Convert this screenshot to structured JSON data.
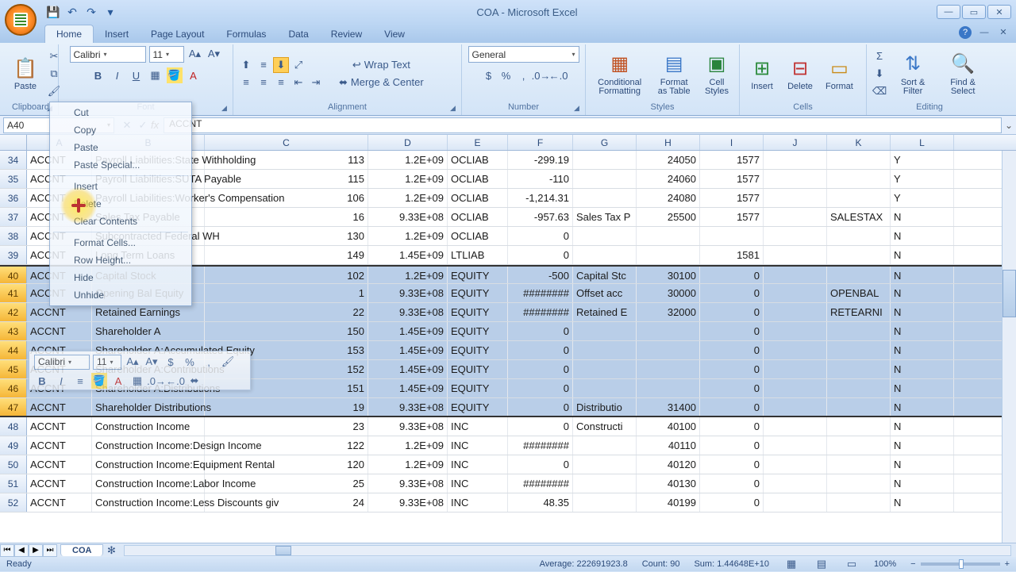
{
  "title": "COA - Microsoft Excel",
  "tabs": [
    "Home",
    "Insert",
    "Page Layout",
    "Formulas",
    "Data",
    "Review",
    "View"
  ],
  "active_tab": "Home",
  "qat": {
    "save": "💾",
    "undo": "↶",
    "redo": "↷"
  },
  "ribbon": {
    "clipboard": {
      "label": "Clipboard",
      "paste": "Paste"
    },
    "font": {
      "label": "Font",
      "name": "Calibri",
      "size": "11"
    },
    "alignment": {
      "label": "Alignment",
      "wrap": "Wrap Text",
      "merge": "Merge & Center"
    },
    "number": {
      "label": "Number",
      "fmt": "General"
    },
    "styles": {
      "label": "Styles",
      "cond": "Conditional Formatting",
      "tbl": "Format as Table",
      "cell": "Cell Styles"
    },
    "cells": {
      "label": "Cells",
      "insert": "Insert",
      "delete": "Delete",
      "format": "Format"
    },
    "editing": {
      "label": "Editing",
      "sort": "Sort & Filter",
      "find": "Find & Select"
    }
  },
  "name_box": "A40",
  "formula": "ACCNT",
  "columns": [
    "A",
    "B",
    "C",
    "D",
    "E",
    "F",
    "G",
    "H",
    "I",
    "J",
    "K",
    "L"
  ],
  "col_widths": [
    "c-A",
    "c-B",
    "c-C",
    "c-D",
    "c-E",
    "c-F",
    "c-G",
    "c-H",
    "c-I",
    "c-J",
    "c-K",
    "c-L"
  ],
  "rows": [
    {
      "n": 34,
      "A": "ACCNT",
      "B": "Payroll Liabilities:State Withholding",
      "C": "113",
      "D": "1.2E+09",
      "E": "OCLIAB",
      "F": "-299.19",
      "G": "",
      "H": "24050",
      "I": "1577",
      "J": "",
      "K": "",
      "L": "Y"
    },
    {
      "n": 35,
      "A": "ACCNT",
      "B": "Payroll Liabilities:SUTA Payable",
      "C": "115",
      "D": "1.2E+09",
      "E": "OCLIAB",
      "F": "-110",
      "G": "",
      "H": "24060",
      "I": "1577",
      "J": "",
      "K": "",
      "L": "Y"
    },
    {
      "n": 36,
      "A": "ACCNT",
      "B": "Payroll Liabilities:Worker's Compensation",
      "C": "106",
      "D": "1.2E+09",
      "E": "OCLIAB",
      "F": "-1,214.31",
      "G": "",
      "H": "24080",
      "I": "1577",
      "J": "",
      "K": "",
      "L": "Y"
    },
    {
      "n": 37,
      "A": "ACCNT",
      "B": "Sales Tax Payable",
      "C": "16",
      "D": "9.33E+08",
      "E": "OCLIAB",
      "F": "-957.63",
      "G": "Sales Tax P",
      "H": "25500",
      "I": "1577",
      "J": "",
      "K": "SALESTAX",
      "L": "N"
    },
    {
      "n": 38,
      "A": "ACCNT",
      "B": "Subcontracted Federal WH",
      "C": "130",
      "D": "1.2E+09",
      "E": "OCLIAB",
      "F": "0",
      "G": "",
      "H": "",
      "I": "",
      "J": "",
      "K": "",
      "L": "N"
    },
    {
      "n": 39,
      "A": "ACCNT",
      "B": "Long Term Loans",
      "C": "149",
      "D": "1.45E+09",
      "E": "LTLIAB",
      "F": "0",
      "G": "",
      "H": "",
      "I": "1581",
      "J": "",
      "K": "",
      "L": "N"
    },
    {
      "n": 40,
      "sel": true,
      "A": "ACCNT",
      "B": "Capital Stock",
      "C": "102",
      "D": "1.2E+09",
      "E": "EQUITY",
      "F": "-500",
      "G": "Capital Stc",
      "H": "30100",
      "I": "0",
      "J": "",
      "K": "",
      "L": "N"
    },
    {
      "n": 41,
      "sel": true,
      "A": "ACCNT",
      "B": "Opening Bal Equity",
      "C": "1",
      "D": "9.33E+08",
      "E": "EQUITY",
      "F": "########",
      "G": "Offset acc",
      "H": "30000",
      "I": "0",
      "J": "",
      "K": "OPENBAL",
      "L": "N"
    },
    {
      "n": 42,
      "sel": true,
      "A": "ACCNT",
      "B": "Retained Earnings",
      "C": "22",
      "D": "9.33E+08",
      "E": "EQUITY",
      "F": "########",
      "G": "Retained E",
      "H": "32000",
      "I": "0",
      "J": "",
      "K": "RETEARNI",
      "L": "N"
    },
    {
      "n": 43,
      "sel": true,
      "A": "ACCNT",
      "B": "Shareholder A",
      "C": "150",
      "D": "1.45E+09",
      "E": "EQUITY",
      "F": "0",
      "G": "",
      "H": "",
      "I": "0",
      "J": "",
      "K": "",
      "L": "N"
    },
    {
      "n": 44,
      "sel": true,
      "A": "ACCNT",
      "B": "Shareholder A:Accumulated Equity",
      "C": "153",
      "D": "1.45E+09",
      "E": "EQUITY",
      "F": "0",
      "G": "",
      "H": "",
      "I": "0",
      "J": "",
      "K": "",
      "L": "N"
    },
    {
      "n": 45,
      "sel": true,
      "A": "ACCNT",
      "B": "Shareholder A:Contributions",
      "C": "152",
      "D": "1.45E+09",
      "E": "EQUITY",
      "F": "0",
      "G": "",
      "H": "",
      "I": "0",
      "J": "",
      "K": "",
      "L": "N"
    },
    {
      "n": 46,
      "sel": true,
      "A": "ACCNT",
      "B": "Shareholder A:Distributions",
      "C": "151",
      "D": "1.45E+09",
      "E": "EQUITY",
      "F": "0",
      "G": "",
      "H": "",
      "I": "0",
      "J": "",
      "K": "",
      "L": "N"
    },
    {
      "n": 47,
      "sel": true,
      "A": "ACCNT",
      "B": "Shareholder Distributions",
      "C": "19",
      "D": "9.33E+08",
      "E": "EQUITY",
      "F": "0",
      "G": "Distributio",
      "H": "31400",
      "I": "0",
      "J": "",
      "K": "",
      "L": "N"
    },
    {
      "n": 48,
      "A": "ACCNT",
      "B": "Construction Income",
      "C": "23",
      "D": "9.33E+08",
      "E": "INC",
      "F": "0",
      "G": "Constructi",
      "H": "40100",
      "I": "0",
      "J": "",
      "K": "",
      "L": "N"
    },
    {
      "n": 49,
      "A": "ACCNT",
      "B": "Construction Income:Design Income",
      "C": "122",
      "D": "1.2E+09",
      "E": "INC",
      "F": "########",
      "G": "",
      "H": "40110",
      "I": "0",
      "J": "",
      "K": "",
      "L": "N"
    },
    {
      "n": 50,
      "A": "ACCNT",
      "B": "Construction Income:Equipment Rental",
      "C": "120",
      "D": "1.2E+09",
      "E": "INC",
      "F": "0",
      "G": "",
      "H": "40120",
      "I": "0",
      "J": "",
      "K": "",
      "L": "N"
    },
    {
      "n": 51,
      "A": "ACCNT",
      "B": "Construction Income:Labor Income",
      "C": "25",
      "D": "9.33E+08",
      "E": "INC",
      "F": "########",
      "G": "",
      "H": "40130",
      "I": "0",
      "J": "",
      "K": "",
      "L": "N"
    },
    {
      "n": 52,
      "A": "ACCNT",
      "B": "Construction Income:Less Discounts giv",
      "C": "24",
      "D": "9.33E+08",
      "E": "INC",
      "F": "48.35",
      "G": "",
      "H": "40199",
      "I": "0",
      "J": "",
      "K": "",
      "L": "N"
    }
  ],
  "context_menu": [
    "Cut",
    "Copy",
    "Paste",
    "Paste Special...",
    "-",
    "Insert",
    "Delete",
    "Clear Contents",
    "-",
    "Format Cells...",
    "Row Height...",
    "Hide",
    "Unhide"
  ],
  "mini_toolbar": {
    "font": "Calibri",
    "size": "11"
  },
  "sheet_tab": "COA",
  "status": {
    "ready": "Ready",
    "avg_label": "Average:",
    "avg": "222691923.8",
    "count_label": "Count:",
    "count": "90",
    "sum_label": "Sum:",
    "sum": "1.44648E+10",
    "zoom": "100%"
  }
}
